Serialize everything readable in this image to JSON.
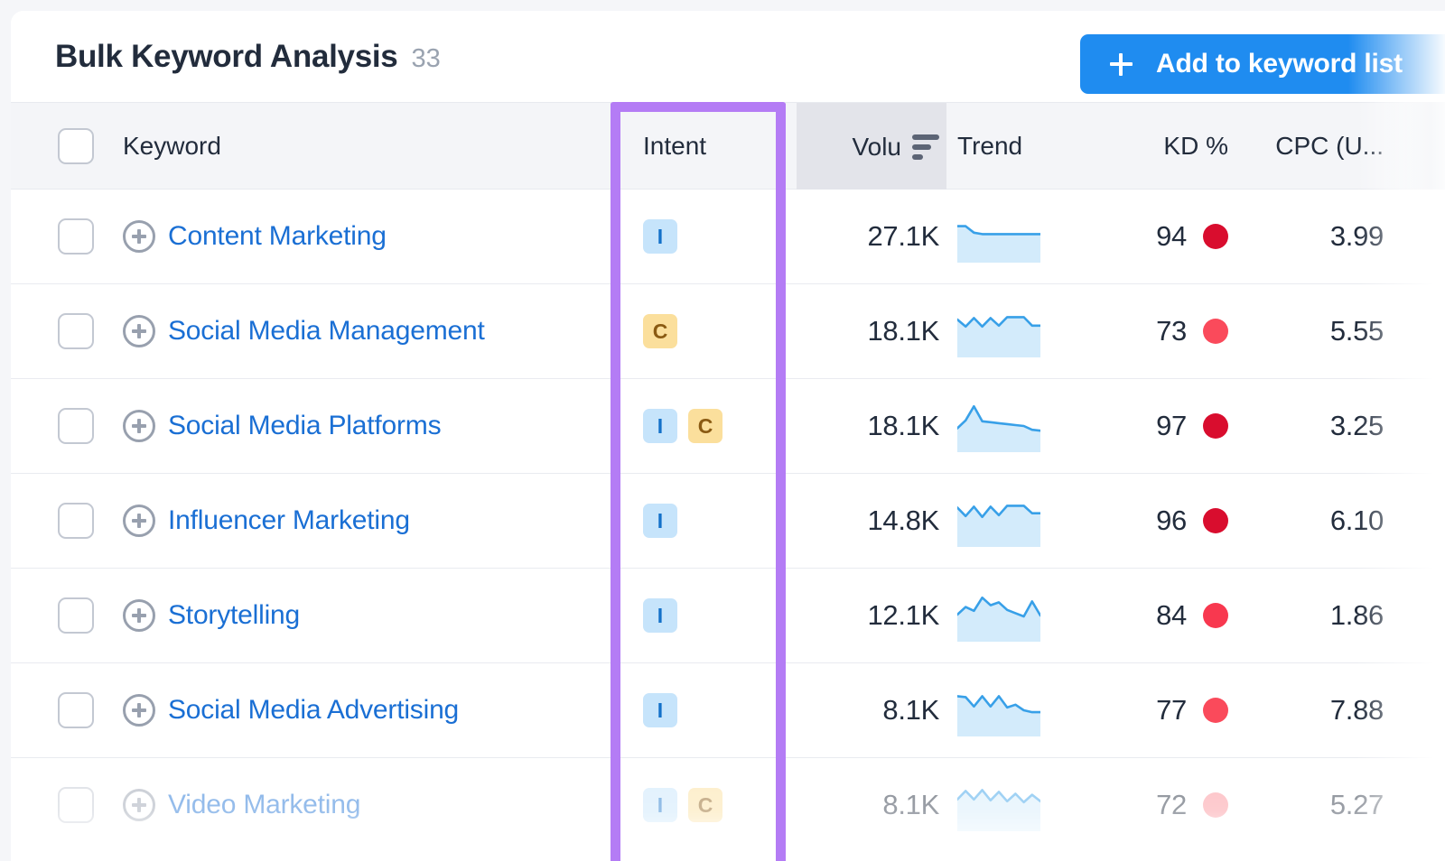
{
  "header": {
    "title": "Bulk Keyword Analysis",
    "count": "33",
    "add_button_label": "Add to keyword list",
    "plus_icon": "plus-icon",
    "accent_color": "#1f8cf0"
  },
  "highlight": {
    "color": "#b47cf5",
    "target_column": "Intent"
  },
  "table": {
    "columns": {
      "keyword": "Keyword",
      "intent": "Intent",
      "volume": "Volu",
      "volume_full": "Volume",
      "trend": "Trend",
      "kd": "KD %",
      "cpc": "CPC (U..."
    },
    "sorted_column": "volume",
    "sort_icon": "sort-descending-icon",
    "rows": [
      {
        "keyword": "Content Marketing",
        "intent": [
          "I"
        ],
        "volume": "27.1K",
        "trend": [
          72,
          72,
          58,
          55,
          55,
          55,
          55,
          55,
          55,
          55,
          55
        ],
        "kd": "94",
        "kd_color": "#d90d2e",
        "cpc": "3.99",
        "faded": false
      },
      {
        "keyword": "Social Media Management",
        "intent": [
          "C"
        ],
        "volume": "18.1K",
        "trend": [
          75,
          60,
          78,
          60,
          78,
          62,
          80,
          80,
          80,
          62,
          62
        ],
        "kd": "73",
        "kd_color": "#fa4a5b",
        "cpc": "5.55",
        "faded": false
      },
      {
        "keyword": "Social Media Platforms",
        "intent": [
          "I",
          "C"
        ],
        "volume": "18.1K",
        "trend": [
          45,
          62,
          92,
          60,
          58,
          56,
          54,
          52,
          50,
          42,
          40
        ],
        "kd": "97",
        "kd_color": "#d90d2e",
        "cpc": "3.25",
        "faded": false
      },
      {
        "keyword": "Influencer Marketing",
        "intent": [
          "I"
        ],
        "volume": "14.8K",
        "trend": [
          78,
          60,
          80,
          58,
          80,
          62,
          82,
          82,
          82,
          66,
          66
        ],
        "kd": "96",
        "kd_color": "#d90d2e",
        "cpc": "6.10",
        "faded": false
      },
      {
        "keyword": "Storytelling",
        "intent": [
          "I"
        ],
        "volume": "12.1K",
        "trend": [
          52,
          68,
          60,
          88,
          72,
          78,
          62,
          55,
          48,
          80,
          50
        ],
        "kd": "84",
        "kd_color": "#f8384f",
        "cpc": "1.86",
        "faded": false
      },
      {
        "keyword": "Social Media Advertising",
        "intent": [
          "I"
        ],
        "volume": "8.1K",
        "trend": [
          80,
          78,
          58,
          80,
          58,
          80,
          56,
          62,
          50,
          46,
          46
        ],
        "kd": "77",
        "kd_color": "#fa4a5b",
        "cpc": "7.88",
        "faded": false
      },
      {
        "keyword": "Video Marketing",
        "intent": [
          "I",
          "C"
        ],
        "volume": "8.1K",
        "trend": [
          62,
          80,
          62,
          82,
          60,
          78,
          58,
          74,
          56,
          72,
          58
        ],
        "kd": "72",
        "kd_color": "#fb8e96",
        "cpc": "5.27",
        "faded": true
      }
    ]
  }
}
